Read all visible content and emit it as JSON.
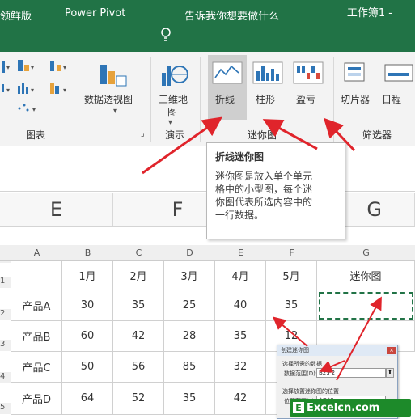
{
  "window": {
    "title": "工作簿1  -"
  },
  "menu": {
    "items": [
      "领鲜版",
      "Power Pivot",
      "告诉我你想要做什么"
    ]
  },
  "ribbon": {
    "charts_group": "图表",
    "pivot_chart": "数据透视图",
    "tour_group": "演示",
    "map3d_line1": "三维地",
    "map3d_line2": "图",
    "sparkline_group": "迷你图",
    "sparkline_line": "折线",
    "sparkline_column": "柱形",
    "sparkline_winloss": "盈亏",
    "filter_group": "筛选器",
    "slicer": "切片器",
    "timeline": "日程"
  },
  "tooltip": {
    "title": "折线迷你图",
    "lines": [
      "迷你图是放入单个单元",
      "格中的小型图，每个迷",
      "你图代表所选内容中的",
      "一行数据。"
    ]
  },
  "big_headers": [
    "E",
    "F",
    "G"
  ],
  "sheet": {
    "col_headers": [
      "A",
      "B",
      "C",
      "D",
      "E",
      "F",
      "G"
    ],
    "header_row": [
      "",
      "1月",
      "2月",
      "3月",
      "4月",
      "5月",
      "迷你图"
    ],
    "row_numbers": [
      "1",
      "2",
      "3",
      "4",
      "5"
    ],
    "rows": [
      [
        "产品A",
        "30",
        "35",
        "25",
        "40",
        "35"
      ],
      [
        "产品B",
        "60",
        "42",
        "28",
        "35",
        "12"
      ],
      [
        "产品C",
        "50",
        "56",
        "85",
        "32",
        ""
      ],
      [
        "产品D",
        "64",
        "52",
        "35",
        "42",
        ""
      ]
    ]
  },
  "dialog": {
    "title": "创建迷你图",
    "data_section": "选择所需的数据",
    "data_range_label": "数据范围(D):",
    "data_range_value": "B2:F2",
    "location_section": "选择放置迷你图的位置",
    "location_label": "位置范围(L):",
    "location_value": "$G$2"
  },
  "watermark": {
    "text": "Excelcn.com",
    "letter": "E"
  },
  "colors": {
    "excel_green": "#217346",
    "arrow_red": "#e0242b",
    "selection": "#217346"
  }
}
